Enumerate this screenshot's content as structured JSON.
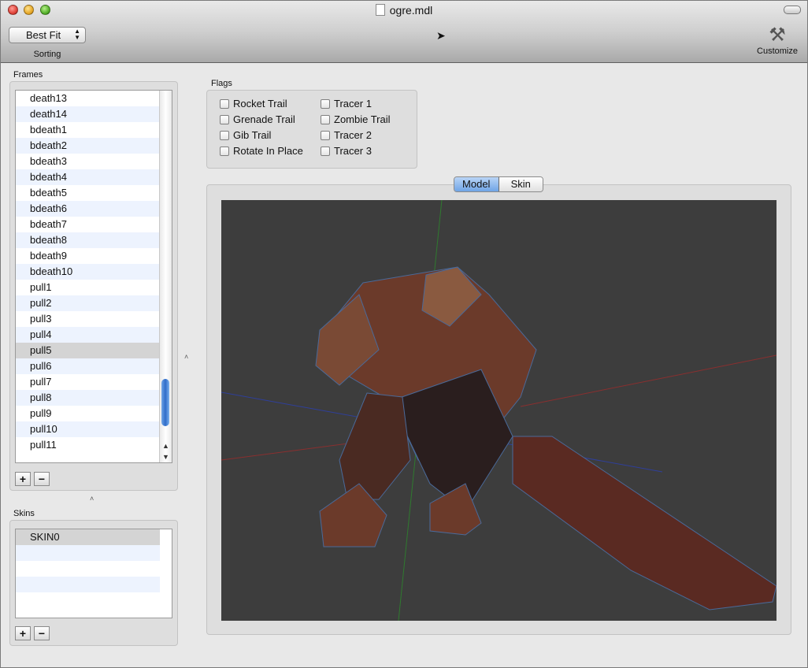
{
  "window": {
    "title": "ogre.mdl"
  },
  "toolbar": {
    "sort_value": "Best Fit",
    "sort_label": "Sorting",
    "customize_label": "Customize"
  },
  "frames": {
    "label": "Frames",
    "items": [
      "death13",
      "death14",
      "bdeath1",
      "bdeath2",
      "bdeath3",
      "bdeath4",
      "bdeath5",
      "bdeath6",
      "bdeath7",
      "bdeath8",
      "bdeath9",
      "bdeath10",
      "pull1",
      "pull2",
      "pull3",
      "pull4",
      "pull5",
      "pull6",
      "pull7",
      "pull8",
      "pull9",
      "pull10",
      "pull11"
    ],
    "selected": "pull5",
    "add": "+",
    "remove": "−"
  },
  "skins": {
    "label": "Skins",
    "items": [
      "SKIN0"
    ],
    "add": "+",
    "remove": "−"
  },
  "flags": {
    "label": "Flags",
    "col1": [
      "Rocket Trail",
      "Grenade Trail",
      "Gib Trail",
      "Rotate In Place"
    ],
    "col2": [
      "Tracer 1",
      "Zombie Trail",
      "Tracer 2",
      "Tracer 3"
    ]
  },
  "view_tabs": {
    "model": "Model",
    "skin": "Skin",
    "selected": "Model"
  },
  "icons": {
    "doc": "document-icon",
    "customize": "hammer-wrench-icon",
    "cursor": "mouse-pointer-icon"
  }
}
